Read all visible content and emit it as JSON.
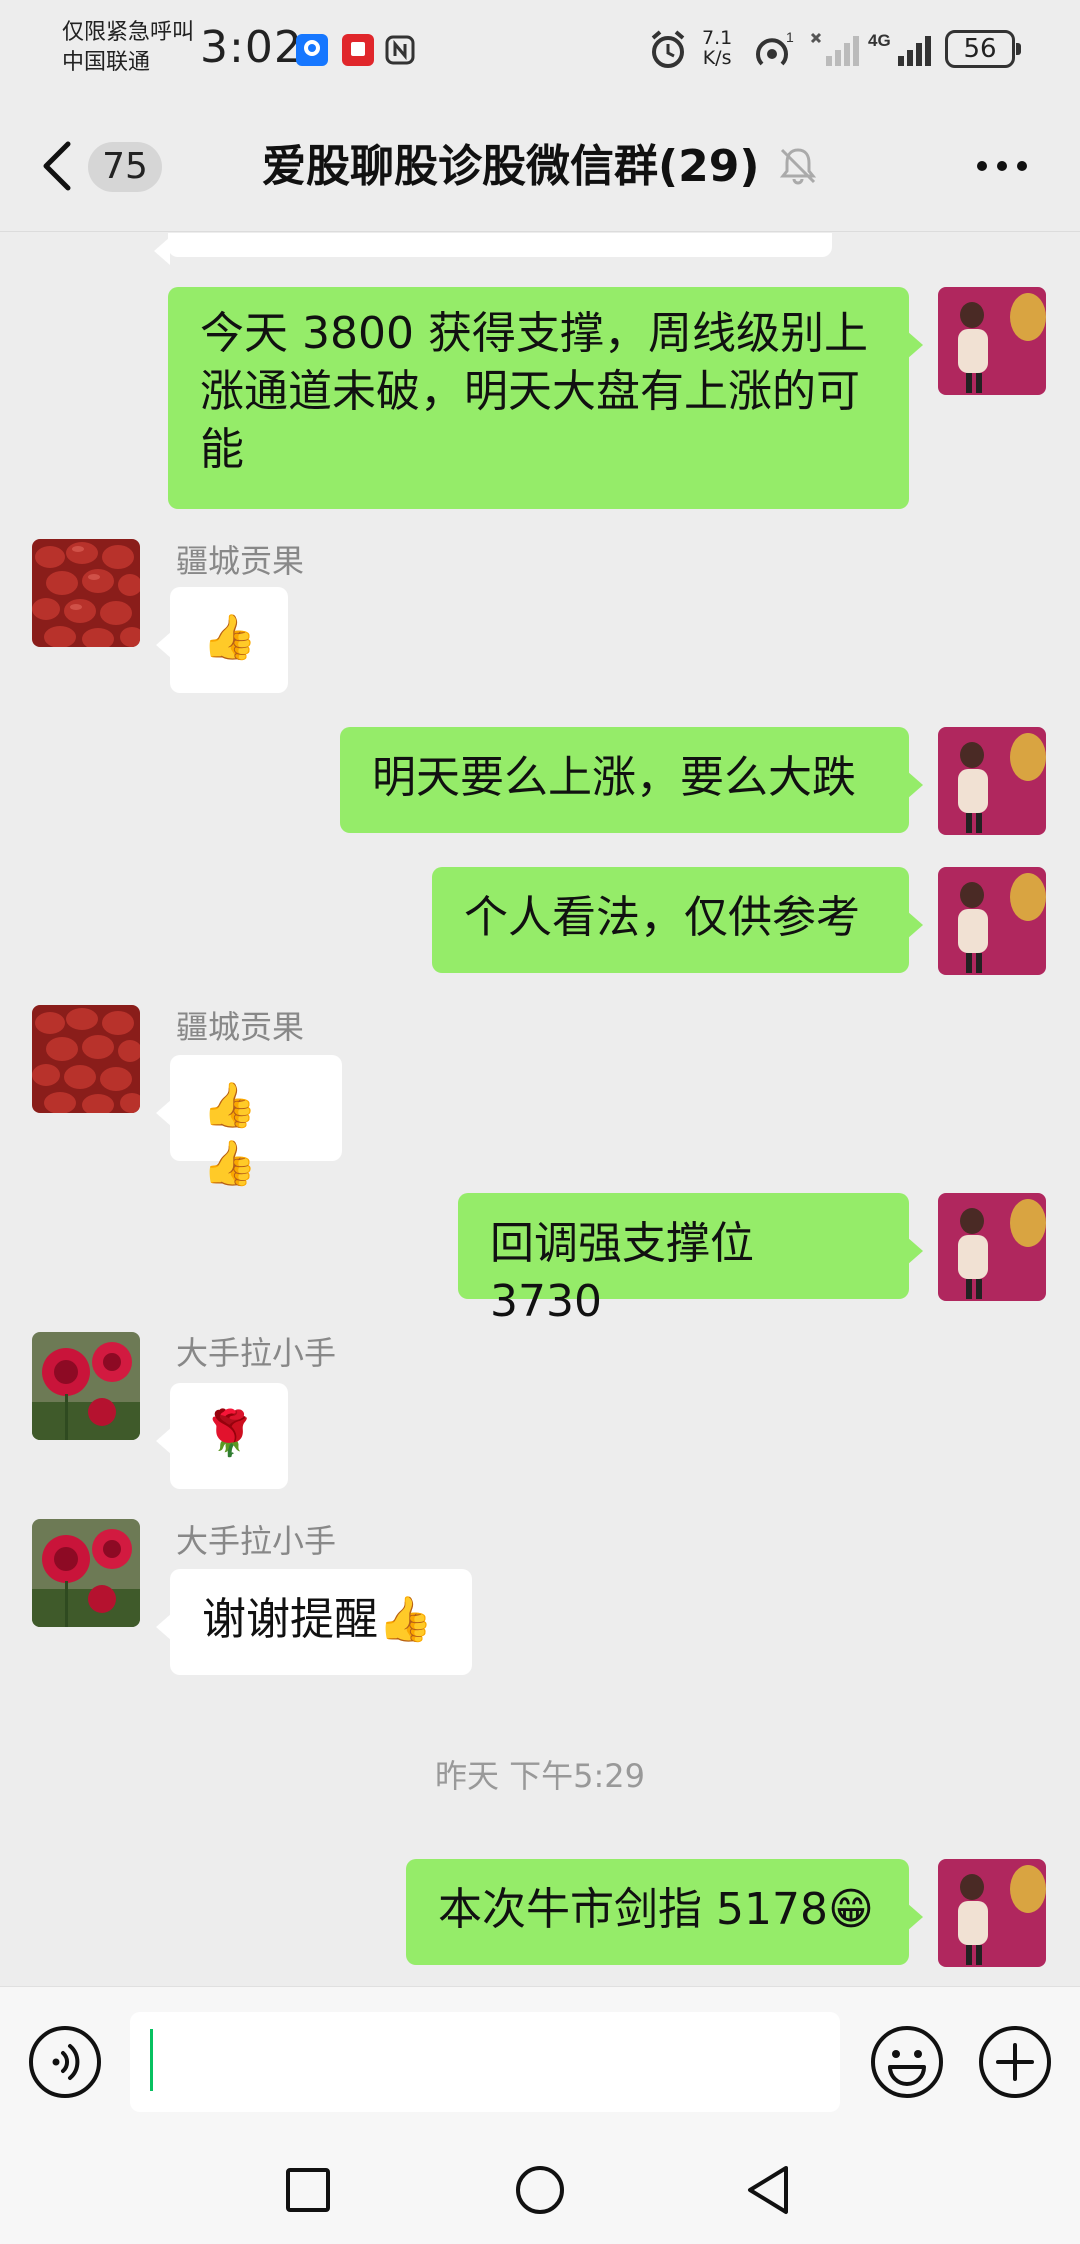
{
  "status_bar": {
    "carrier_line1": "仅限紧急呼叫",
    "carrier_line2": "中国联通",
    "time": "3:02",
    "net_speed_value": "7.1",
    "net_speed_unit": "K/s",
    "battery": "56",
    "network_label": "4G"
  },
  "header": {
    "unread_count": "75",
    "title": "爱股聊股诊股微信群(29)"
  },
  "messages": [
    {
      "side": "out",
      "text_line1": "今天 3800 获得支撑，周线级别上",
      "text_line2": "涨通道未破，明天大盘有上涨的可",
      "text_line3": "能"
    },
    {
      "side": "in",
      "sender": "疆城贡果",
      "text": "👍"
    },
    {
      "side": "out",
      "text": "明天要么上涨，要么大跌"
    },
    {
      "side": "out",
      "text": "个人看法，仅供参考"
    },
    {
      "side": "in",
      "sender": "疆城贡果",
      "text": "👍👍"
    },
    {
      "side": "out",
      "text": "回调强支撑位 3730"
    },
    {
      "side": "in",
      "sender": "大手拉小手",
      "text": "🌹"
    },
    {
      "side": "in",
      "sender": "大手拉小手",
      "text": "谢谢提醒👍"
    },
    {
      "side": "out",
      "text": "本次牛市剑指 5178😁"
    }
  ],
  "time_divider": "昨天 下午5:29",
  "input": {
    "value": "",
    "placeholder": ""
  },
  "colors": {
    "outgoing_bubble": "#95ec69",
    "incoming_bubble": "#ffffff",
    "background": "#ededed",
    "cursor": "#07c160"
  },
  "icons": [
    "back-icon",
    "mute-icon",
    "more-icon",
    "voice-icon",
    "emoji-icon",
    "plus-icon",
    "recent-apps-icon",
    "home-icon",
    "back-nav-icon"
  ]
}
